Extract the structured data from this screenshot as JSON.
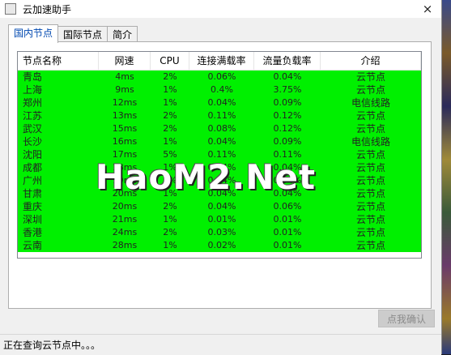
{
  "window": {
    "title": "云加速助手"
  },
  "tabs": [
    {
      "label": "国内节点",
      "active": true
    },
    {
      "label": "国际节点",
      "active": false
    },
    {
      "label": "简介",
      "active": false
    }
  ],
  "table": {
    "columns": [
      "节点名称",
      "网速",
      "CPU",
      "连接满载率",
      "流量负载率",
      "介绍"
    ],
    "rows": [
      [
        "青岛",
        "4ms",
        "2%",
        "0.06%",
        "0.04%",
        "云节点"
      ],
      [
        "上海",
        "9ms",
        "1%",
        "0.4%",
        "3.75%",
        "云节点"
      ],
      [
        "郑州",
        "12ms",
        "1%",
        "0.04%",
        "0.09%",
        "电信线路"
      ],
      [
        "江苏",
        "13ms",
        "2%",
        "0.11%",
        "0.12%",
        "云节点"
      ],
      [
        "武汉",
        "15ms",
        "2%",
        "0.08%",
        "0.12%",
        "云节点"
      ],
      [
        "长沙",
        "16ms",
        "1%",
        "0.04%",
        "0.09%",
        "电信线路"
      ],
      [
        "沈阳",
        "17ms",
        "5%",
        "0.11%",
        "0.11%",
        "云节点"
      ],
      [
        "成都",
        "18ms",
        "1%",
        "0.04%",
        "0.04%",
        "云节点"
      ],
      [
        "广州",
        "19ms",
        "1%",
        "0.04%",
        "0.04%",
        "云节点"
      ],
      [
        "甘肃",
        "20ms",
        "1%",
        "0.04%",
        "0.04%",
        "云节点"
      ],
      [
        "重庆",
        "20ms",
        "2%",
        "0.04%",
        "0.06%",
        "云节点"
      ],
      [
        "深圳",
        "21ms",
        "1%",
        "0.01%",
        "0.01%",
        "云节点"
      ],
      [
        "香港",
        "24ms",
        "2%",
        "0.03%",
        "0.01%",
        "云节点"
      ],
      [
        "云南",
        "28ms",
        "1%",
        "0.02%",
        "0.01%",
        "云节点"
      ]
    ]
  },
  "watermark": "HaoM2.Net",
  "buttons": {
    "confirm": "点我确认"
  },
  "status": {
    "text": "正在查询云节点中。。。"
  },
  "icons": {
    "close": "×"
  },
  "colors": {
    "row_bg": "#00f000",
    "accent": "#0048b0"
  }
}
